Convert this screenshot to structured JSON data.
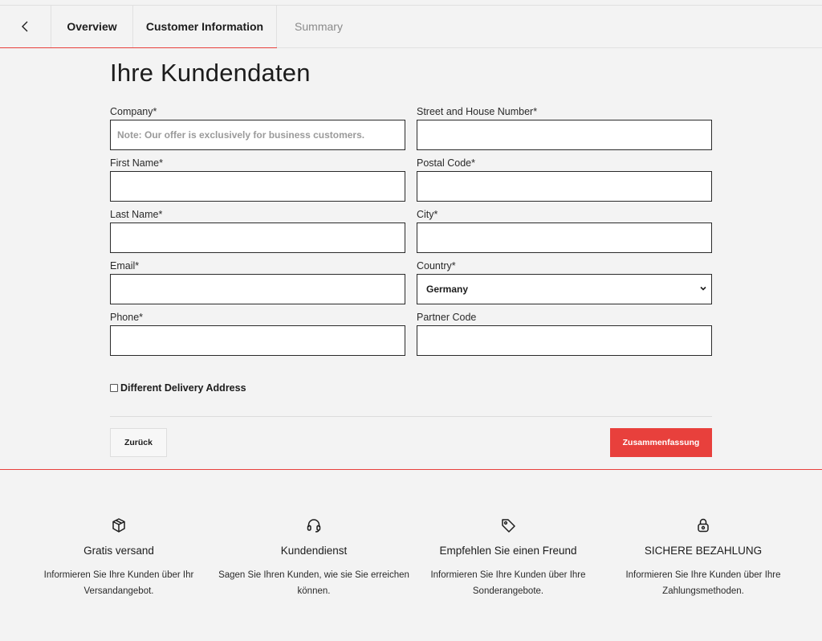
{
  "nav": {
    "tabs": [
      {
        "label": "Overview"
      },
      {
        "label": "Customer Information"
      },
      {
        "label": "Summary"
      }
    ]
  },
  "page": {
    "title": "Ihre Kundendaten"
  },
  "form": {
    "company": {
      "label": "Company*",
      "placeholder": "Note: Our offer is exclusively for business customers."
    },
    "first_name": {
      "label": "First Name*"
    },
    "last_name": {
      "label": "Last Name*"
    },
    "email": {
      "label": "Email*"
    },
    "phone": {
      "label": "Phone*"
    },
    "street": {
      "label": "Street and House Number*"
    },
    "postal_code": {
      "label": "Postal Code*"
    },
    "city": {
      "label": "City*"
    },
    "country": {
      "label": "Country*",
      "value": "Germany"
    },
    "partner_code": {
      "label": "Partner Code"
    },
    "different_delivery": {
      "label": "Different Delivery Address"
    }
  },
  "actions": {
    "back_label": "Zurück",
    "next_label": "Zusammenfassung"
  },
  "features": [
    {
      "icon": "box-icon",
      "title": "Gratis versand",
      "text": "Informieren Sie Ihre Kunden über Ihr Versandangebot."
    },
    {
      "icon": "headset-icon",
      "title": "Kundendienst",
      "text": "Sagen Sie Ihren Kunden, wie sie Sie erreichen können."
    },
    {
      "icon": "tag-icon",
      "title": "Empfehlen Sie einen Freund",
      "text": "Informieren Sie Ihre Kunden über Ihre Sonderangebote."
    },
    {
      "icon": "lock-icon",
      "title": "SICHERE BEZAHLUNG",
      "text": "Informieren Sie Ihre Kunden über Ihre Zahlungsmethoden."
    }
  ],
  "colors": {
    "accent": "#e8403c",
    "background": "#f3f3f3",
    "text": "#1c1c1c"
  }
}
